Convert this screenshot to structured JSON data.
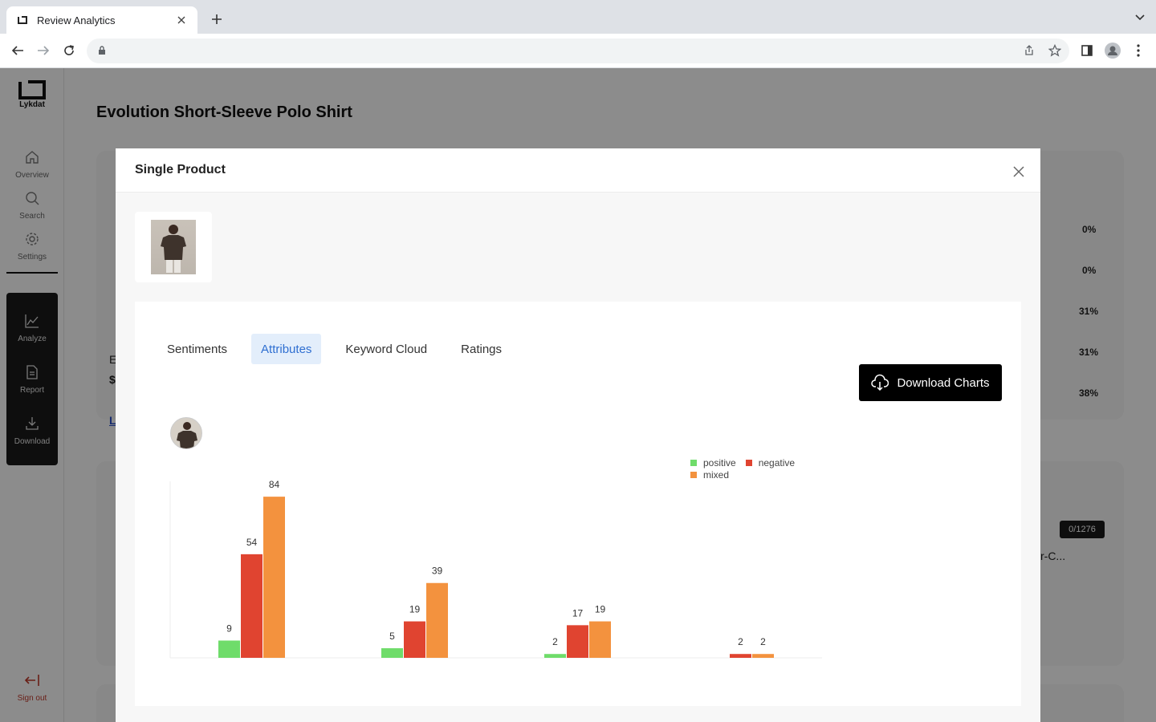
{
  "browser": {
    "tab_title": "Review Analytics",
    "url": ""
  },
  "sidebar": {
    "logo_text": "Lykdat",
    "nav_items": [
      {
        "label": "Overview",
        "icon": "home-icon"
      },
      {
        "label": "Search",
        "icon": "search-icon"
      },
      {
        "label": "Settings",
        "icon": "gear-icon"
      }
    ],
    "tool_items": [
      {
        "label": "Analyze",
        "icon": "line-chart-icon"
      },
      {
        "label": "Report",
        "icon": "document-icon"
      },
      {
        "label": "Download",
        "icon": "download-icon"
      }
    ],
    "signout_label": "Sign out"
  },
  "page": {
    "title": "Evolution Short-Sleeve Polo Shirt",
    "bg_percentages": [
      "0%",
      "0%",
      "31%",
      "31%",
      "38%"
    ],
    "bg_badge": "0/1276",
    "bg_product_text": "r-C...",
    "bg_fragments": [
      "E",
      "$",
      "L"
    ]
  },
  "modal": {
    "title": "Single Product",
    "tabs": [
      {
        "label": "Sentiments",
        "active": false
      },
      {
        "label": "Attributes",
        "active": true
      },
      {
        "label": "Keyword Cloud",
        "active": false
      },
      {
        "label": "Ratings",
        "active": false
      }
    ],
    "download_label": "Download Charts"
  },
  "colors": {
    "positive": "#6fdc6a",
    "negative": "#e04430",
    "mixed": "#f3923e",
    "active_tab_bg": "#e3eefb",
    "active_tab_text": "#2f6fd1"
  },
  "chart_data": {
    "type": "bar",
    "categories": [
      "",
      "",
      "",
      ""
    ],
    "series": [
      {
        "name": "positive",
        "values": [
          9,
          5,
          2,
          0
        ]
      },
      {
        "name": "negative",
        "values": [
          54,
          19,
          17,
          2
        ]
      },
      {
        "name": "mixed",
        "values": [
          84,
          39,
          19,
          2
        ]
      }
    ],
    "title": "",
    "xlabel": "",
    "ylabel": "",
    "ylim": [
      0,
      92
    ],
    "grid": false,
    "legend": "top-right",
    "labels_shown": [
      [
        true,
        true,
        true
      ],
      [
        true,
        true,
        true
      ],
      [
        true,
        true,
        true
      ],
      [
        false,
        true,
        true
      ]
    ]
  }
}
